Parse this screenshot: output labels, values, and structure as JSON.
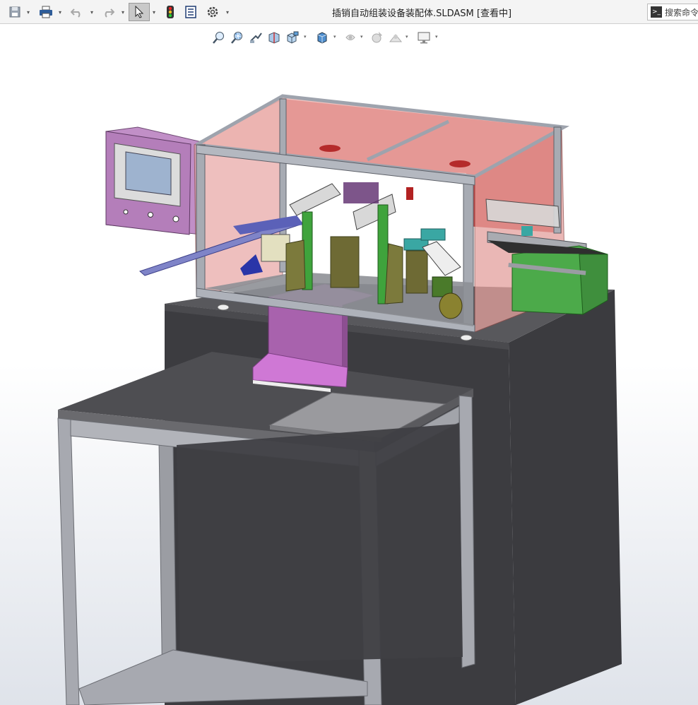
{
  "window": {
    "title": "插销自动组装设备装配体.SLDASM [查看中]"
  },
  "search": {
    "label": "搜索命令"
  },
  "toolbar": {
    "icons": [
      "save-icon",
      "print-icon",
      "undo-icon",
      "redo-icon",
      "select-arrow-icon",
      "rebuild-traffic-light-icon",
      "file-properties-icon",
      "options-gear-icon"
    ]
  },
  "heads_up": {
    "icons": [
      "zoom-to-fit-icon",
      "zoom-to-area-icon",
      "previous-view-icon",
      "section-view-icon",
      "view-orientation-icon",
      "display-style-icon",
      "hide-show-items-icon",
      "edit-appearance-icon",
      "apply-scene-icon",
      "view-settings-icon"
    ]
  },
  "colors": {
    "frame": "#9ea3ad",
    "panel_red": "#c83a3a",
    "pink_glass": "#e9a7a5",
    "table_top": "#4d4d4d",
    "cabinet": "#3e3e42",
    "magenta": "#cf6fd6",
    "green": "#3fa33c",
    "olive": "#7c7a3c",
    "teal": "#3aa7a3",
    "hmi_purple": "#c392c9"
  }
}
